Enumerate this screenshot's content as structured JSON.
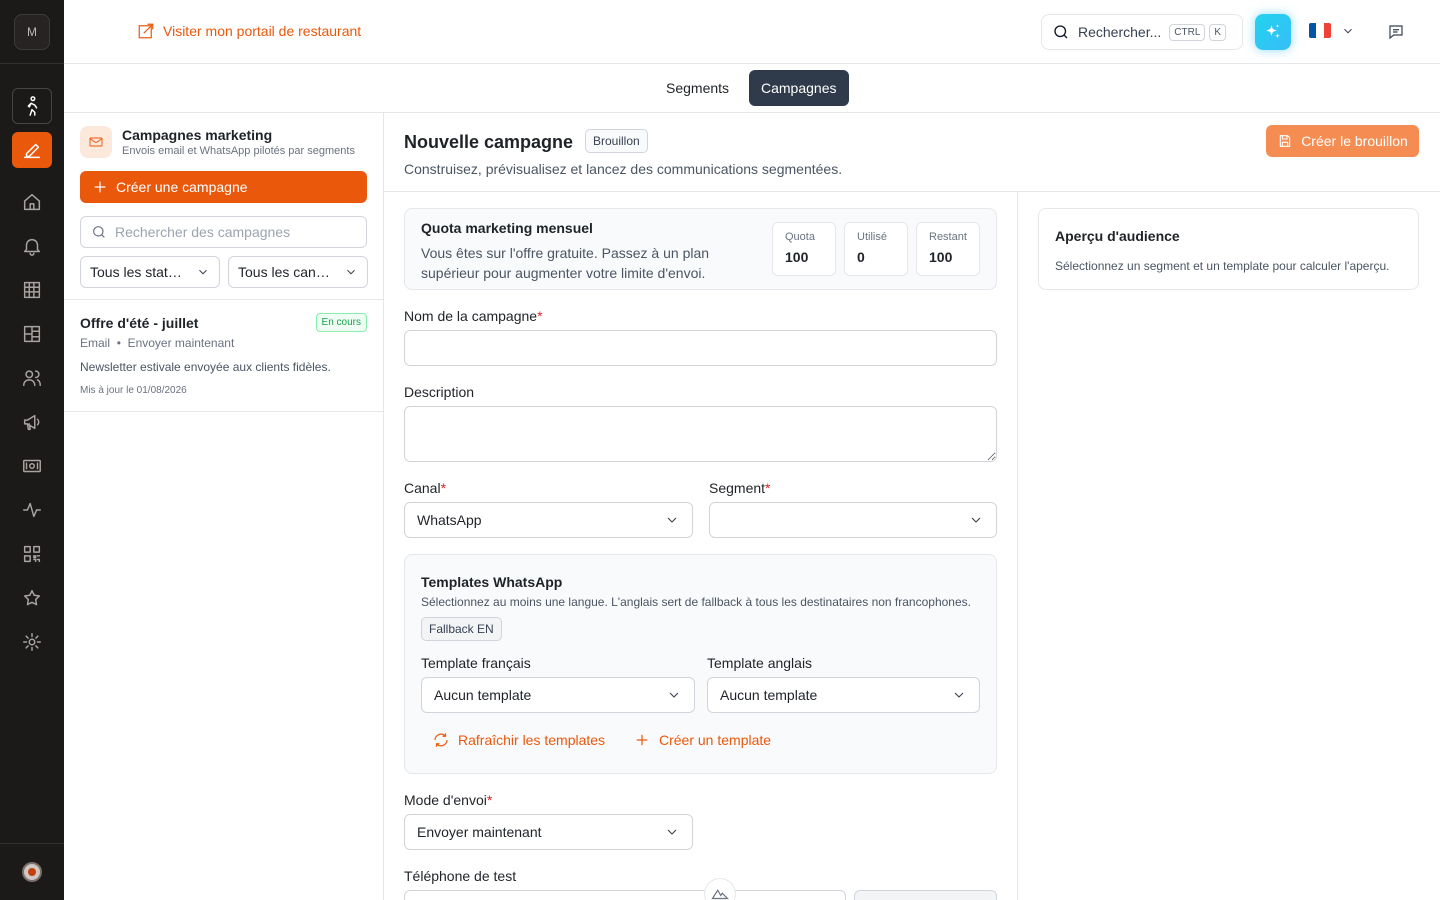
{
  "rail": {
    "logo_letter": "M",
    "items": [
      {
        "name": "walk-icon"
      },
      {
        "name": "edit-icon"
      },
      {
        "name": "home-icon"
      },
      {
        "name": "bell-icon"
      },
      {
        "name": "grid-icon"
      },
      {
        "name": "layout-icon"
      },
      {
        "name": "users-icon"
      },
      {
        "name": "megaphone-icon"
      },
      {
        "name": "cash-icon"
      },
      {
        "name": "activity-icon"
      },
      {
        "name": "qr-code-icon"
      },
      {
        "name": "star-icon"
      },
      {
        "name": "settings-icon"
      }
    ]
  },
  "header": {
    "portal_link": "Visiter mon portail de restaurant",
    "search_label": "Rechercher...",
    "kbd_ctrl": "CTRL",
    "kbd_k": "K",
    "language": "fr",
    "flag_colors": [
      "#0055A4",
      "#FFFFFF",
      "#EF4135"
    ]
  },
  "tabs": {
    "segments": "Segments",
    "campagnes": "Campagnes",
    "active": "Campagnes"
  },
  "left": {
    "title": "Campagnes marketing",
    "subtitle": "Envois email et WhatsApp pilotés par segments",
    "create_button": "Créer une campagne",
    "search_placeholder": "Rechercher des campagnes",
    "filter_status": "Tous les statuts",
    "filter_channel": "Tous les canaux",
    "campaigns": [
      {
        "name": "Offre d'été - juillet",
        "status": "En cours",
        "channel": "Email",
        "separator": "•",
        "mode": "Envoyer maintenant",
        "description": "Newsletter estivale envoyée aux clients fidèles.",
        "updated": "Mis à jour le 01/08/2026"
      }
    ]
  },
  "main": {
    "title": "Nouvelle campagne",
    "badge": "Brouillon",
    "subtitle": "Construisez, prévisualisez et lancez des communications segmentées.",
    "draft_button": "Créer le brouillon",
    "quota": {
      "title": "Quota marketing mensuel",
      "text": "Vous êtes sur l'offre gratuite. Passez à un plan supérieur pour augmenter votre limite d'envoi.",
      "cards": [
        {
          "label": "Quota",
          "value": "100"
        },
        {
          "label": "Utilisé",
          "value": "0"
        },
        {
          "label": "Restant",
          "value": "100"
        }
      ]
    },
    "name_label": "Nom de la campagne",
    "required_mark": "*",
    "description_label": "Description",
    "canal_label": "Canal",
    "canal_value": "WhatsApp",
    "segment_label": "Segment",
    "segment_value": "",
    "templates": {
      "title": "Templates WhatsApp",
      "subtitle": "Sélectionnez au moins une langue. L'anglais sert de fallback à tous les destinataires non francophones.",
      "badge": "Fallback EN",
      "fr_label": "Template français",
      "fr_value": "Aucun template",
      "en_label": "Template anglais",
      "en_value": "Aucun template",
      "refresh": "Rafraîchir les templates",
      "create": "Créer un template"
    },
    "send_mode_label": "Mode d'envoi",
    "send_mode_value": "Envoyer maintenant",
    "test_phone_label": "Téléphone de test"
  },
  "preview": {
    "title": "Aperçu d'audience",
    "subtitle": "Sélectionnez un segment et un template pour calculer l'aperçu."
  }
}
